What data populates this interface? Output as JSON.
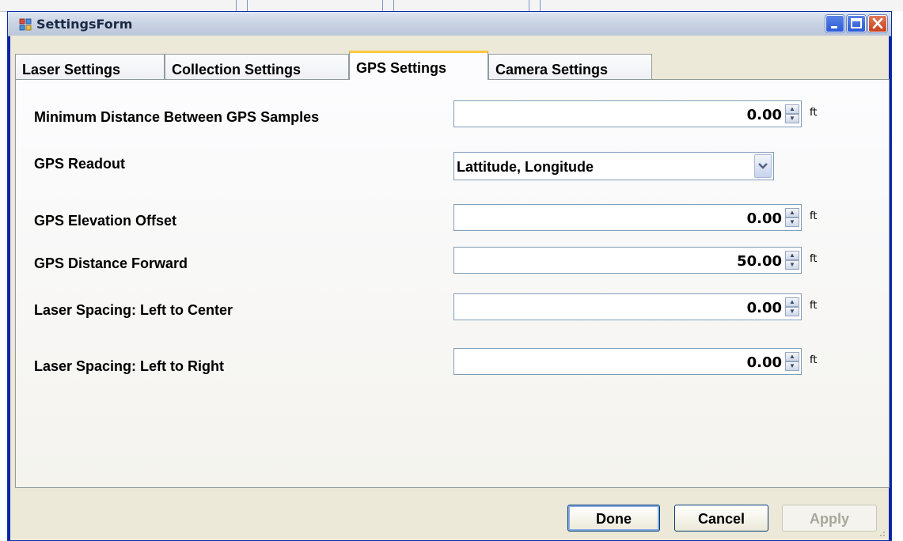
{
  "window": {
    "title": "SettingsForm",
    "controls": [
      "minimize-icon",
      "maximize-icon",
      "close-icon"
    ]
  },
  "tabs": [
    {
      "label": "Laser Settings",
      "active": false
    },
    {
      "label": "Collection Settings",
      "active": false
    },
    {
      "label": "GPS Settings",
      "active": true
    },
    {
      "label": "Camera Settings",
      "active": false
    }
  ],
  "fields": {
    "min_distance": {
      "label": "Minimum Distance Between GPS Samples",
      "value": "0.00",
      "unit": "ft"
    },
    "gps_readout": {
      "label": "GPS Readout",
      "value": "Lattitude, Longitude"
    },
    "elevation_offset": {
      "label": "GPS Elevation Offset",
      "value": "0.00",
      "unit": "ft"
    },
    "distance_forward": {
      "label": "GPS Distance Forward",
      "value": "50.00",
      "unit": "ft"
    },
    "left_to_center": {
      "label": "Laser Spacing: Left to Center",
      "value": "0.00",
      "unit": "ft"
    },
    "left_to_right": {
      "label": "Laser Spacing: Left to Right",
      "value": "0.00",
      "unit": "ft"
    }
  },
  "buttons": {
    "done": "Done",
    "cancel": "Cancel",
    "apply": "Apply"
  },
  "colors": {
    "titlebar": "#cbd4e4",
    "client": "#ece9d8",
    "active_tab_accent": "#ffc83c",
    "close_button": "#c8401c"
  }
}
